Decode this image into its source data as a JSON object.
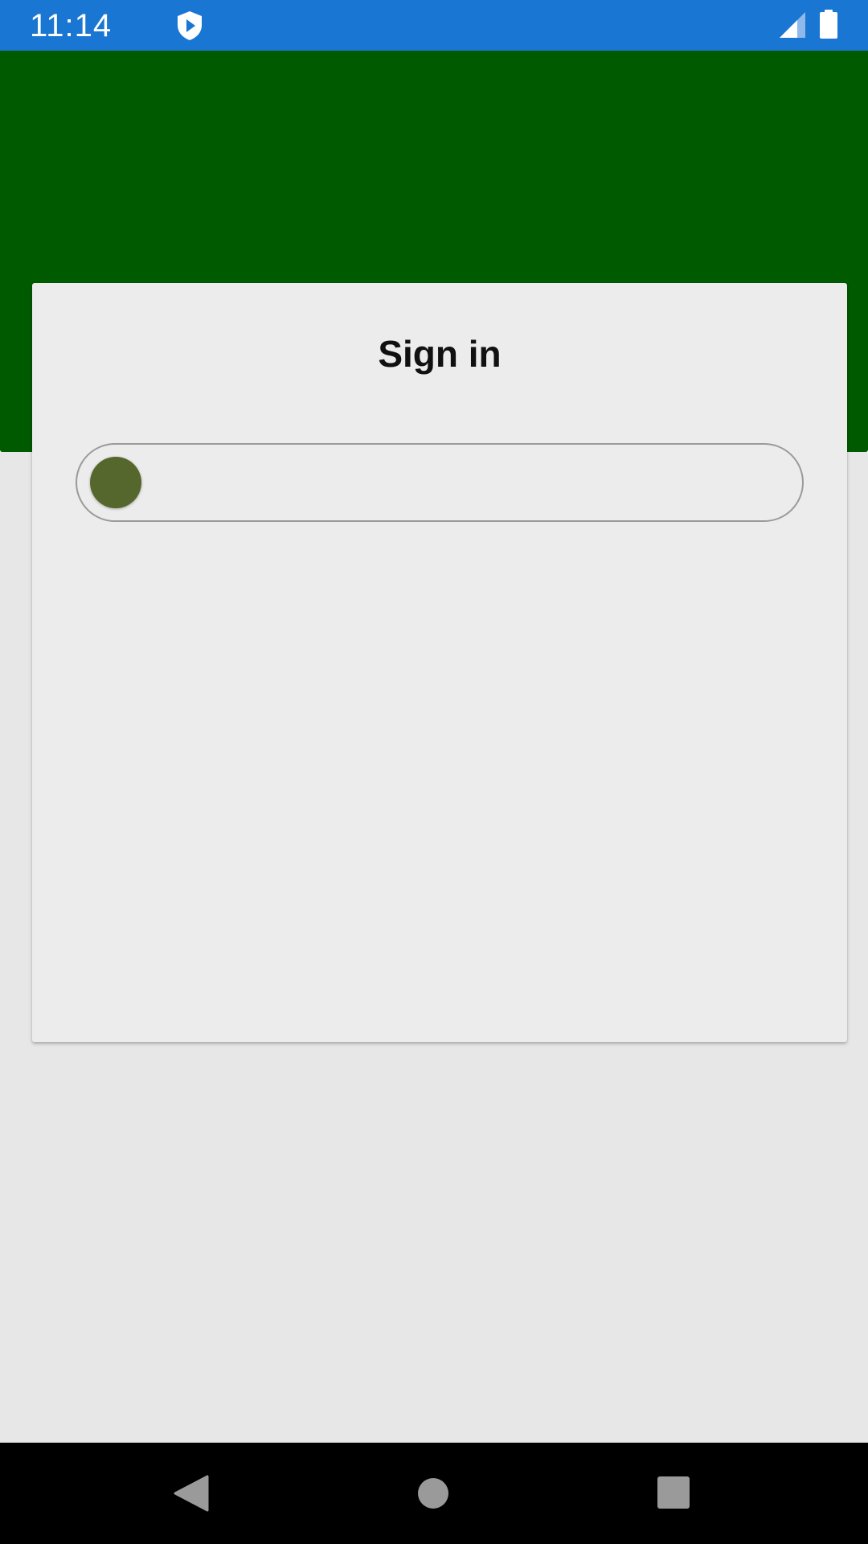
{
  "status_bar": {
    "time": "11:14",
    "icons": [
      "shield-icon",
      "signal-icon",
      "battery-icon"
    ],
    "background": "#1976d2"
  },
  "header": {
    "background": "#005b00"
  },
  "card": {
    "title": "Sign in",
    "slider": {
      "value": 0,
      "knob_color": "#55672d"
    }
  },
  "nav_bar": {
    "icons": [
      "back-icon",
      "home-icon",
      "recents-icon"
    ]
  }
}
